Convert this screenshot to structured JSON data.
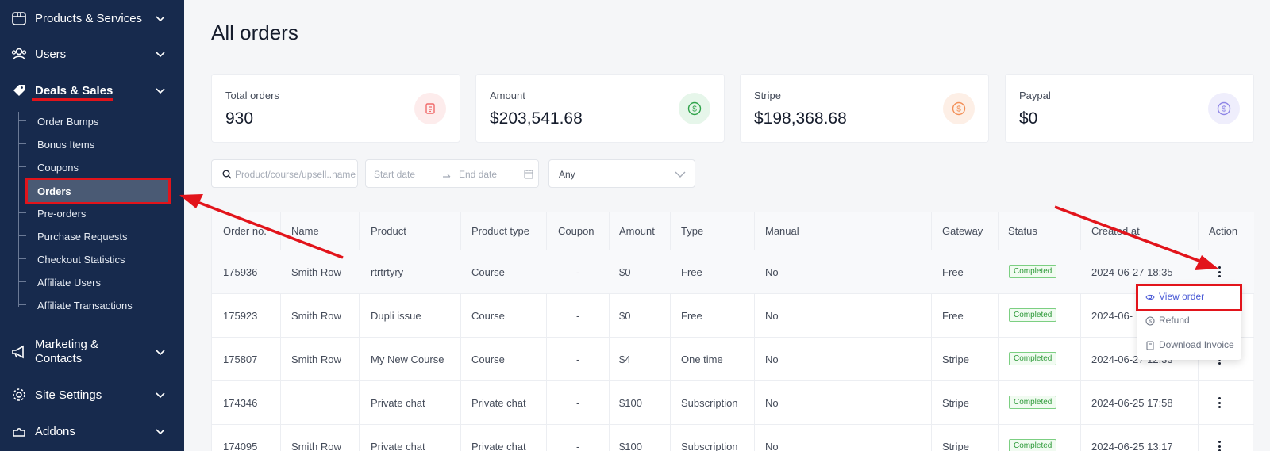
{
  "sidebar": {
    "top_items": [
      {
        "label": "Products & Services",
        "icon": "box-icon"
      },
      {
        "label": "Users",
        "icon": "users-icon"
      },
      {
        "label": "Deals & Sales",
        "icon": "tag-icon"
      }
    ],
    "sub_items": [
      "Order Bumps",
      "Bonus Items",
      "Coupons",
      "Orders",
      "Pre-orders",
      "Purchase Requests",
      "Checkout Statistics",
      "Affiliate Users",
      "Affiliate Transactions"
    ],
    "active_sub_item": "Orders",
    "bottom_items": [
      {
        "label_line1": "Marketing &",
        "label_line2": "Contacts",
        "icon": "megaphone-icon"
      },
      {
        "label": "Site Settings",
        "icon": "gear-icon"
      },
      {
        "label": "Addons",
        "icon": "puzzle-icon"
      }
    ]
  },
  "page": {
    "title": "All orders"
  },
  "cards": [
    {
      "label": "Total orders",
      "value": "930",
      "icon": "clipboard-icon",
      "color": "#f06a6a",
      "bg": "#fdecec"
    },
    {
      "label": "Amount",
      "value": "$203,541.68",
      "icon": "dollar-icon",
      "color": "#2fa34a",
      "bg": "#e6f6ea"
    },
    {
      "label": "Stripe",
      "value": "$198,368.68",
      "icon": "dollar-icon",
      "color": "#f39058",
      "bg": "#fdefe6"
    },
    {
      "label": "Paypal",
      "value": "$0",
      "icon": "dollar-icon",
      "color": "#8f86e6",
      "bg": "#efeefc"
    }
  ],
  "filters": {
    "search_placeholder": "Product/course/upsell..name",
    "start_date_placeholder": "Start date",
    "end_date_placeholder": "End date",
    "status_select": "Any"
  },
  "table": {
    "columns": [
      "Order no.",
      "Name",
      "Product",
      "Product type",
      "Coupon",
      "Amount",
      "Type",
      "Manual",
      "Gateway",
      "Status",
      "Created at",
      "Action"
    ],
    "rows": [
      {
        "order_no": "175936",
        "name": "Smith Row",
        "product": "rtrtrtyry",
        "product_type": "Course",
        "coupon": "-",
        "amount": "$0",
        "type": "Free",
        "manual": "No",
        "gateway": "Free",
        "status": "Completed",
        "created_at": "2024-06-27 18:35"
      },
      {
        "order_no": "175923",
        "name": "Smith Row",
        "product": "Dupli issue",
        "product_type": "Course",
        "coupon": "-",
        "amount": "$0",
        "type": "Free",
        "manual": "No",
        "gateway": "Free",
        "status": "Completed",
        "created_at": "2024-06-"
      },
      {
        "order_no": "175807",
        "name": "Smith Row",
        "product": "My New Course",
        "product_type": "Course",
        "coupon": "-",
        "amount": "$4",
        "type": "One time",
        "manual": "No",
        "gateway": "Stripe",
        "status": "Completed",
        "created_at": "2024-06-27 12:33"
      },
      {
        "order_no": "174346",
        "name": "",
        "product": "Private chat",
        "product_type": "Private chat",
        "coupon": "-",
        "amount": "$100",
        "type": "Subscription",
        "manual": "No",
        "gateway": "Stripe",
        "status": "Completed",
        "created_at": "2024-06-25 17:58"
      },
      {
        "order_no": "174095",
        "name": "Smith Row",
        "product": "Private chat",
        "product_type": "Private chat",
        "coupon": "-",
        "amount": "$100",
        "type": "Subscription",
        "manual": "No",
        "gateway": "Stripe",
        "status": "Completed",
        "created_at": "2024-06-25 13:17"
      }
    ]
  },
  "action_menu": {
    "items": [
      {
        "label": "View order",
        "icon": "eye-icon"
      },
      {
        "label": "Refund",
        "icon": "dollar-circle-icon"
      },
      {
        "label": "Download Invoice",
        "icon": "document-icon"
      }
    ]
  },
  "annotations": {
    "highlight_color": "#e2141b"
  }
}
